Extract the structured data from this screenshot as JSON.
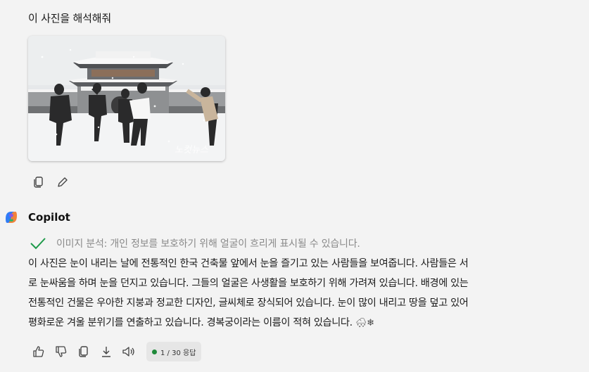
{
  "user_message": {
    "text": "이 사진을 해석해줘"
  },
  "assistant": {
    "name": "Copilot",
    "analysis_note": "이미지 분석: 개인 정보를 보호하기 위해 얼굴이 흐리게 표시될 수 있습니다.",
    "answer_lines": [
      "이 사진은 눈이 내리는 날에 전통적인 한국 건축물 앞에서 눈을 즐기고 있는 사람들을 보여줍니다. 사람들은 서",
      "로 눈싸움을 하며 눈을 던지고 있습니다. 그들의 얼굴은 사생활을 보호하기 위해 가려져 있습니다. 배경에 있는",
      "전통적인 건물은 우아한 지붕과 정교한 디자인, 글씨체로 장식되어 있습니다. 눈이 많이 내리고 땅을 덮고 있어",
      "평화로운 겨울 분위기를 연출하고 있습니다. 경복궁이라는 이름이 적혀 있습니다."
    ],
    "answer_emoji": "🌨❄",
    "response_counter": "1 / 30 응답",
    "counter_dot_color": "#1f8a3a"
  },
  "image": {
    "watermark": "노컷뉴스"
  },
  "icons": {
    "user_actions": [
      "copy-icon",
      "edit-icon"
    ],
    "assistant_actions": [
      "thumbs-up-icon",
      "thumbs-down-icon",
      "copy-icon",
      "download-icon",
      "speaker-icon"
    ],
    "analysis": "checkmark-icon",
    "logo": "copilot-logo-icon"
  }
}
